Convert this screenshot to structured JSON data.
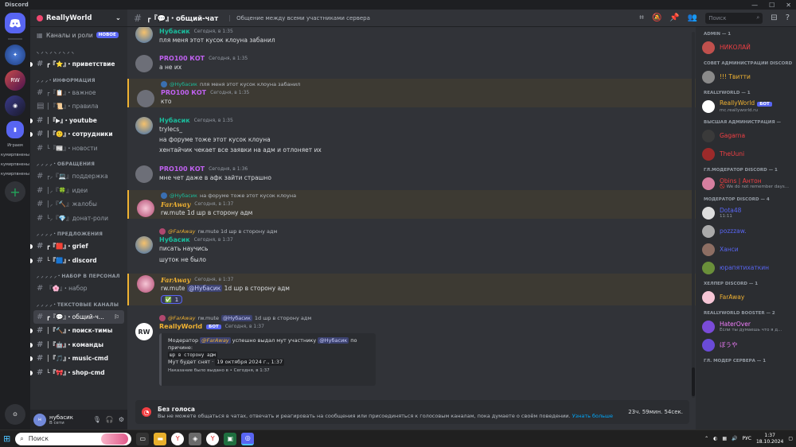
{
  "window": {
    "title": "Discord"
  },
  "server_rail": {
    "items": [
      {
        "label": "Играем"
      },
      {
        "label": "кумирпвнены"
      },
      {
        "label": "кумирпвнены"
      },
      {
        "label": "кумирпвнены"
      }
    ]
  },
  "guild": {
    "name": "ReallyWorld",
    "channels_roles": "Каналы и роли",
    "new_badge": "НОВОЕ"
  },
  "sidebar": {
    "top_cat": "⸜ ⸝ ⸜ ⸝ ⸜ ⸝ ⸜ ⸝ ⸜",
    "welcome": "┏『⭐』・приветствие",
    "cat_info": "⸝ ⸝ ⸝・ИНФОРМАЦИЯ",
    "info": [
      "┌『📋』・важное",
      "│『📜』・правила",
      "│『▶』・youtube",
      "│『🙂』・сотрудники",
      "└『📰』・новости"
    ],
    "cat_req": "⸝ ⸝ ⸝ ⸝・ОБРАЩЕНИЯ",
    "req": [
      "┌⸝『💻』поддержка",
      "│⸝『🍀』идеи",
      "│⸝『🔨』жалобы",
      "└⸝『💎』донат-роли"
    ],
    "cat_sugg": "⸝ ⸝ ⸝ ⸝・ПРЕДЛОЖЕНИЯ",
    "sugg": [
      "┏『🟥』・grief",
      "└『🟦』・discord"
    ],
    "cat_staff": "⸝ ⸝ ⸝ ⸝ ⸝・НАБОР В ПЕРСОНАЛ",
    "staff": [
      "『🌸』・набор"
    ],
    "cat_text": "⸝ ⸝ ⸝ ⸝・ТЕКСТОВЫЕ КАНАЛЫ",
    "text": [
      "┏『💬』・общий-ч...",
      "│『🔨』・поиск-тимы",
      "│『🤖』・команды",
      "│『🎵』・music-cmd",
      "└『🎀』・shop-cmd"
    ]
  },
  "user": {
    "name": "нубасик",
    "status": "В сети"
  },
  "header": {
    "channel": "┏『💬』・общий-чат",
    "topic": "Общение между всеми участниками сервера",
    "search": "Поиск"
  },
  "messages": [
    {
      "author": "Нубасик",
      "time": "Сегодня, в 1:35",
      "lines": [
        "пля меня этот кусок клоуна забанил"
      ]
    },
    {
      "author": "PRO100 КОТ",
      "time": "Сегодня, в 1:35",
      "lines": [
        "а не их"
      ]
    },
    {
      "reply_author": "@Нубасик",
      "reply_text": "пля меня этот кусок клоуна забанил",
      "author": "PRO100 КОТ",
      "time": "Сегодня, в 1:35",
      "lines": [
        "кто"
      ]
    },
    {
      "author": "Нубасик",
      "time": "Сегодня, в 1:35",
      "lines": [
        "trylecs_",
        "на форуме тоже этот кусок клоуна",
        "хентайчик чекает все заявки на адм и отлоняет их"
      ]
    },
    {
      "author": "PRO100 КОТ",
      "time": "Сегодня, в 1:36",
      "lines": [
        "мне чет даже в афк зайти страшно"
      ]
    },
    {
      "reply_author": "@Нубасик",
      "reply_text": "на форуме тоже этот кусок клоуна",
      "author": "FarAway",
      "time": "Сегодня, в 1:37",
      "lines": [
        "rw.mute 1d шр в сторону адм"
      ]
    },
    {
      "reply_author": "@FarAway",
      "reply_text": "rw.mute 1d шр в сторону адм",
      "author": "Нубасик",
      "time": "Сегодня, в 1:37",
      "lines": [
        "писать научись",
        "шуток не было"
      ]
    },
    {
      "author": "FarAway",
      "time": "Сегодня, в 1:37",
      "pre": "rw.mute",
      "mention": "@Нубасик",
      "post": "1d шр в сторону адм",
      "reaction": "1"
    },
    {
      "reply_author": "@FarAway",
      "reply_text": "rw.mute",
      "reply_mention": "@Нубасик",
      "reply_post": "1d шр в сторону адм",
      "author": "ReallyWorld",
      "bot": "БОТ",
      "time": "Сегодня, в 1:37",
      "embed": {
        "l1a": "Модератор",
        "l1m": "@FarAway",
        "l1b": "успешно выдал мут участнику",
        "l1m2": "@Нубасик",
        "l1c": "по",
        "l2": "причине:",
        "code": "шр в сторону адм",
        "l4a": "Мут будет снят ·",
        "l4b": "19 октября 2024 г., 1:37",
        "foot": "Наказание было выдано в • Сегодня, в 1:37"
      }
    }
  ],
  "notice": {
    "title": "Без голоса",
    "desc": "Вы не можете общаться в чатах, отвечать и реагировать на сообщения или присоединяться к голосовым каналам, пока думаете о своём поведении.",
    "link": "Узнать больше",
    "timer": "23ч. 59мин. 54сек."
  },
  "members": {
    "groups": [
      {
        "role": "ADMIN — 1",
        "items": [
          {
            "name": "НИКОЛАЙ",
            "color": "#f23f43"
          }
        ]
      },
      {
        "role": "СОВЕТ АДМИНИСТРАЦИИ DISCORD",
        "items": [
          {
            "name": "!!! Твитти",
            "color": "#f0b232"
          }
        ]
      },
      {
        "role": "REALLYWORLD — 1",
        "items": [
          {
            "name": "ReallyWorld",
            "color": "#f0b232",
            "bot": "БОТ",
            "sub": "mc.reallyworld.ru"
          }
        ]
      },
      {
        "role": "ВЫСШАЯ АДМИНИСТРАЦИЯ —",
        "items": [
          {
            "name": "Gagarna",
            "color": "#f23f43"
          },
          {
            "name": "TheUuni",
            "color": "#f23f43"
          }
        ]
      },
      {
        "role": "ГЛ.МОДЕРАТОР DISCORD — 1",
        "items": [
          {
            "name": "Obins | Антон",
            "color": "#f23f43",
            "sub": "🚫 We do not remember days..."
          }
        ]
      },
      {
        "role": "МОДЕРАТОР DISCORD — 4",
        "items": [
          {
            "name": "Dota48",
            "color": "#5865f2",
            "sub": "11:11"
          },
          {
            "name": "pozzzaw.",
            "color": "#5865f2"
          },
          {
            "name": "Ханси",
            "color": "#5865f2"
          },
          {
            "name": "юрапятихаткин",
            "color": "#5865f2"
          }
        ]
      },
      {
        "role": "ХЕЛПЕР DISCORD — 1",
        "items": [
          {
            "name": "FarAway",
            "color": "#f0b232"
          }
        ]
      },
      {
        "role": "REALLYWORLD BOOSTER — 2",
        "items": [
          {
            "name": "HaterOver",
            "color": "#f47fff",
            "sub": "Если ты думаешь что я д..."
          },
          {
            "name": "ぼうや",
            "color": "#f47fff"
          }
        ]
      },
      {
        "role": "ГЛ. МОДЕР СЕРВЕРА — 1",
        "items": []
      }
    ]
  },
  "taskbar": {
    "search": "Поиск",
    "lang": "РУС",
    "time": "1:37",
    "date": "18.10.2024"
  }
}
